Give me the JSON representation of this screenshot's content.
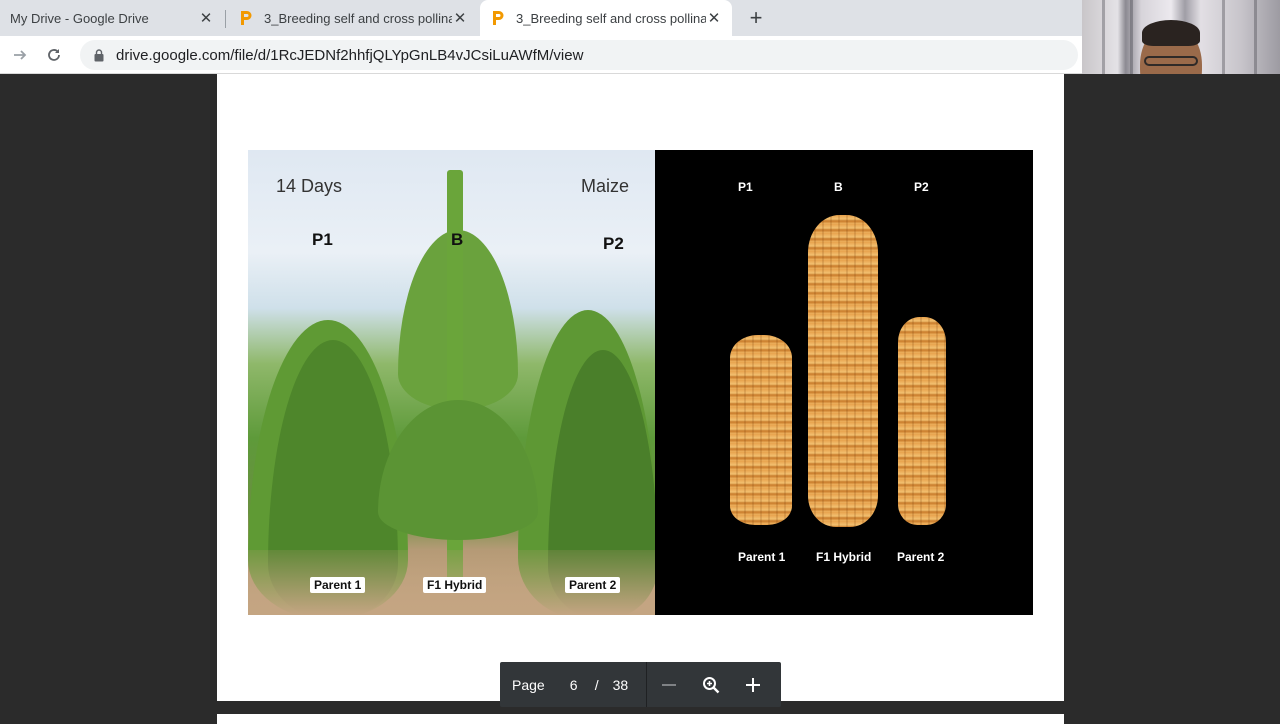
{
  "tabs": [
    {
      "title": "My Drive - Google Drive",
      "active": false
    },
    {
      "title": "3_Breeding self and cross pollina",
      "active": false
    },
    {
      "title": "3_Breeding self and cross pollina",
      "active": true
    }
  ],
  "toolbar": {
    "url": "drive.google.com/file/d/1RcJEDNf2hhfjQLYpGnLB4vJCsiLuAWfM/view"
  },
  "slide": {
    "left_panel": {
      "days": "14 Days",
      "crop": "Maize",
      "p1": "P1",
      "b": "B",
      "p2": "P2",
      "parent1": "Parent 1",
      "hybrid": "F1 Hybrid",
      "parent2": "Parent 2"
    },
    "right_panel": {
      "p1": "P1",
      "b": "B",
      "p2": "P2",
      "parent1": "Parent 1",
      "hybrid": "F1 Hybrid",
      "parent2": "Parent 2"
    }
  },
  "pager": {
    "label": "Page",
    "current": "6",
    "separator": "/",
    "total": "38"
  },
  "colors": {
    "tab_bg": "#dee1e6",
    "viewer_bg": "#2b2b2b",
    "pagebar_bg": "#323639",
    "favicon_slides": "#f29900"
  },
  "icons": [
    "close-icon",
    "slides-favicon",
    "new-tab-icon",
    "forward-icon",
    "reload-icon",
    "lock-icon",
    "zoom-out-icon",
    "zoom-icon",
    "zoom-in-icon"
  ]
}
